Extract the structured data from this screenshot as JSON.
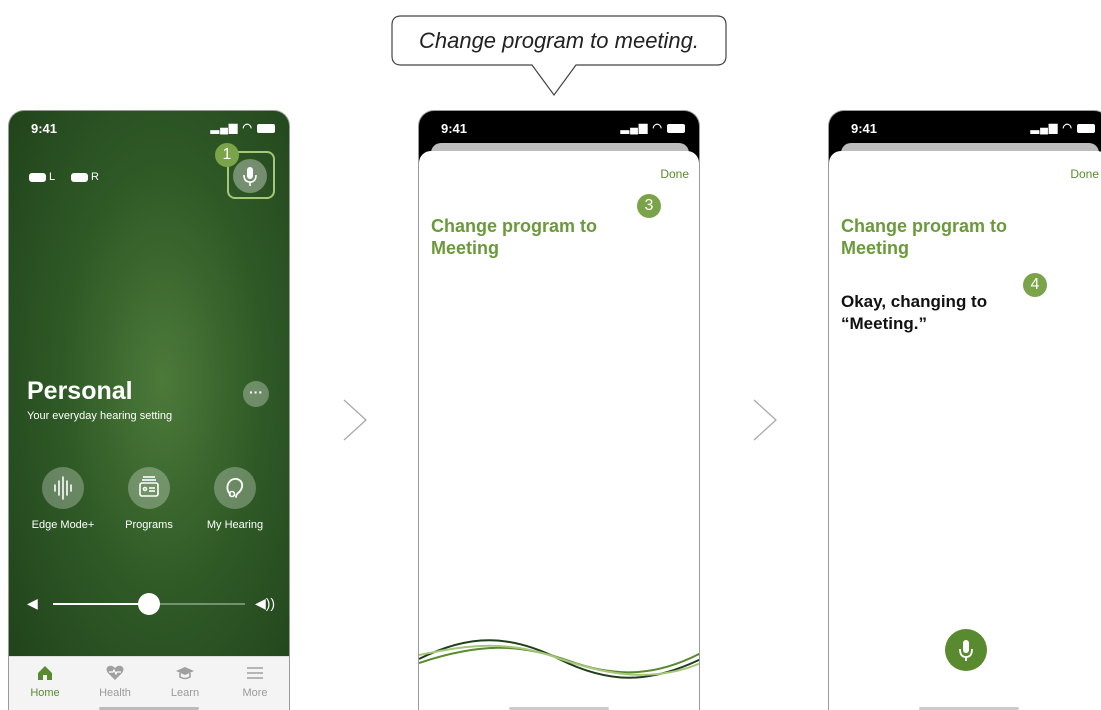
{
  "bubble": {
    "text": "Change program to meeting."
  },
  "phone1": {
    "time": "9:41",
    "battery_left": "L",
    "battery_right": "R",
    "step_badge": "1",
    "program_title": "Personal",
    "program_subtitle": "Your everyday hearing setting",
    "more_label": "···",
    "actions": [
      {
        "label": "Edge Mode+",
        "icon": "edge-mode-icon"
      },
      {
        "label": "Programs",
        "icon": "programs-icon"
      },
      {
        "label": "My Hearing",
        "icon": "my-hearing-icon"
      }
    ],
    "volume_level": 0.5,
    "tabs": [
      {
        "label": "Home",
        "icon": "home-icon",
        "active": true
      },
      {
        "label": "Health",
        "icon": "health-icon",
        "active": false
      },
      {
        "label": "Learn",
        "icon": "learn-icon",
        "active": false
      },
      {
        "label": "More",
        "icon": "menu-icon",
        "active": false
      }
    ]
  },
  "phone2": {
    "time": "9:41",
    "done_label": "Done",
    "query": "Change program to\nMeeting",
    "step_badge": "3"
  },
  "phone3": {
    "time": "9:41",
    "done_label": "Done",
    "query": "Change program to\nMeeting",
    "reply": "Okay, changing to\n“Meeting.”",
    "step_badge": "4"
  },
  "colors": {
    "accent": "#5a8a2f",
    "badge": "#7aa34a",
    "highlight": "#a6c77a"
  }
}
